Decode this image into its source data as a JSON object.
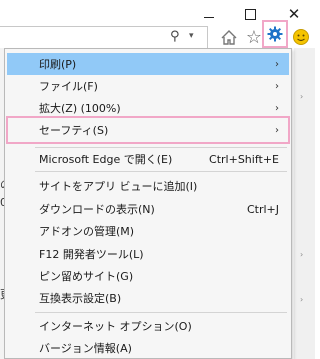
{
  "window_controls": {
    "minimize_glyph": "—",
    "maximize_glyph": "□",
    "close_glyph": "✕"
  },
  "toolbar": {
    "search_glyph": "⚲",
    "dropdown_glyph": "▾",
    "home_icon": "home-icon",
    "favorites_icon": "star-icon",
    "favorites_glyph": "☆",
    "tools_icon": "gear-icon",
    "feedback_icon": "smiley-icon"
  },
  "colors": {
    "highlight": "#91c9f7",
    "callout_outline": "#f1a7c7",
    "gear_blue": "#1e73c8",
    "smiley_yellow": "#f5c400",
    "menu_background": "#f6f6f6"
  },
  "menu": {
    "items": [
      {
        "label": "印刷(P)",
        "submenu": true,
        "highlighted": true
      },
      {
        "label": "ファイル(F)",
        "submenu": true
      },
      {
        "label": "拡大(Z) (100%)",
        "submenu": true
      },
      {
        "label": "セーフティ(S)",
        "submenu": true,
        "outlined": true
      },
      {
        "label": "Microsoft Edge で開く(E)",
        "shortcut": "Ctrl+Shift+E"
      },
      {
        "label": "サイトをアプリ ビューに追加(I)"
      },
      {
        "label": "ダウンロードの表示(N)",
        "shortcut": "Ctrl+J"
      },
      {
        "label": "アドオンの管理(M)"
      },
      {
        "label": "F12 開発者ツール(L)"
      },
      {
        "label": "ピン留めサイト(G)"
      },
      {
        "label": "互換表示設定(B)"
      },
      {
        "label": "インターネット オプション(O)"
      },
      {
        "label": "バージョン情報(A)"
      }
    ],
    "submenu_arrow": "›"
  },
  "background_page": {
    "left_glyphs": [
      "の",
      "0",
      "更"
    ],
    "scroll_arrow": "›"
  }
}
